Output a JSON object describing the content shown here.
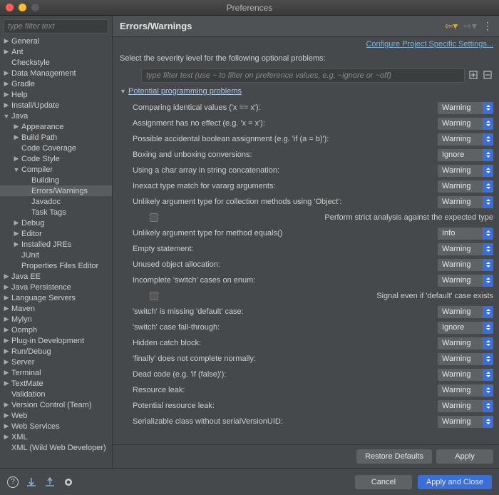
{
  "window": {
    "title": "Preferences"
  },
  "sidebar": {
    "filter_placeholder": "type filter text",
    "items": [
      {
        "l": "General",
        "d": 0,
        "t": "▶"
      },
      {
        "l": "Ant",
        "d": 0,
        "t": "▶"
      },
      {
        "l": "Checkstyle",
        "d": 0,
        "t": ""
      },
      {
        "l": "Data Management",
        "d": 0,
        "t": "▶"
      },
      {
        "l": "Gradle",
        "d": 0,
        "t": "▶"
      },
      {
        "l": "Help",
        "d": 0,
        "t": "▶"
      },
      {
        "l": "Install/Update",
        "d": 0,
        "t": "▶"
      },
      {
        "l": "Java",
        "d": 0,
        "t": "▼"
      },
      {
        "l": "Appearance",
        "d": 1,
        "t": "▶"
      },
      {
        "l": "Build Path",
        "d": 1,
        "t": "▶"
      },
      {
        "l": "Code Coverage",
        "d": 1,
        "t": ""
      },
      {
        "l": "Code Style",
        "d": 1,
        "t": "▶"
      },
      {
        "l": "Compiler",
        "d": 1,
        "t": "▼"
      },
      {
        "l": "Building",
        "d": 2,
        "t": ""
      },
      {
        "l": "Errors/Warnings",
        "d": 2,
        "t": "",
        "sel": true
      },
      {
        "l": "Javadoc",
        "d": 2,
        "t": ""
      },
      {
        "l": "Task Tags",
        "d": 2,
        "t": ""
      },
      {
        "l": "Debug",
        "d": 1,
        "t": "▶"
      },
      {
        "l": "Editor",
        "d": 1,
        "t": "▶"
      },
      {
        "l": "Installed JREs",
        "d": 1,
        "t": "▶"
      },
      {
        "l": "JUnit",
        "d": 1,
        "t": ""
      },
      {
        "l": "Properties Files Editor",
        "d": 1,
        "t": ""
      },
      {
        "l": "Java EE",
        "d": 0,
        "t": "▶"
      },
      {
        "l": "Java Persistence",
        "d": 0,
        "t": "▶"
      },
      {
        "l": "Language Servers",
        "d": 0,
        "t": "▶"
      },
      {
        "l": "Maven",
        "d": 0,
        "t": "▶"
      },
      {
        "l": "Mylyn",
        "d": 0,
        "t": "▶"
      },
      {
        "l": "Oomph",
        "d": 0,
        "t": "▶"
      },
      {
        "l": "Plug-in Development",
        "d": 0,
        "t": "▶"
      },
      {
        "l": "Run/Debug",
        "d": 0,
        "t": "▶"
      },
      {
        "l": "Server",
        "d": 0,
        "t": "▶"
      },
      {
        "l": "Terminal",
        "d": 0,
        "t": "▶"
      },
      {
        "l": "TextMate",
        "d": 0,
        "t": "▶"
      },
      {
        "l": "Validation",
        "d": 0,
        "t": ""
      },
      {
        "l": "Version Control (Team)",
        "d": 0,
        "t": "▶"
      },
      {
        "l": "Web",
        "d": 0,
        "t": "▶"
      },
      {
        "l": "Web Services",
        "d": 0,
        "t": "▶"
      },
      {
        "l": "XML",
        "d": 0,
        "t": "▶"
      },
      {
        "l": "XML (Wild Web Developer)",
        "d": 0,
        "t": ""
      }
    ]
  },
  "page": {
    "title": "Errors/Warnings",
    "config_link": "Configure Project Specific Settings...",
    "instruction": "Select the severity level for the following optional problems:",
    "filter_placeholder": "type filter text (use ~ to filter on preference values, e.g. ~ignore or ~off)",
    "category": "Potential programming problems",
    "settings": [
      {
        "label": "Comparing identical values ('x == x'):",
        "value": "Warning"
      },
      {
        "label": "Assignment has no effect (e.g. 'x = x'):",
        "value": "Warning"
      },
      {
        "label": "Possible accidental boolean assignment (e.g. 'if (a = b)'):",
        "value": "Warning"
      },
      {
        "label": "Boxing and unboxing conversions:",
        "value": "Ignore"
      },
      {
        "label": "Using a char array in string concatenation:",
        "value": "Warning"
      },
      {
        "label": "Inexact type match for vararg arguments:",
        "value": "Warning"
      },
      {
        "label": "Unlikely argument type for collection methods using 'Object':",
        "value": "Warning"
      },
      {
        "sub": true,
        "label": "Perform strict analysis against the expected type"
      },
      {
        "label": "Unlikely argument type for method equals()",
        "value": "Info"
      },
      {
        "label": "Empty statement:",
        "value": "Warning"
      },
      {
        "label": "Unused object allocation:",
        "value": "Warning"
      },
      {
        "label": "Incomplete 'switch' cases on enum:",
        "value": "Warning"
      },
      {
        "sub": true,
        "label": "Signal even if 'default' case exists"
      },
      {
        "label": "'switch' is missing 'default' case:",
        "value": "Warning"
      },
      {
        "label": "'switch' case fall-through:",
        "value": "Ignore"
      },
      {
        "label": "Hidden catch block:",
        "value": "Warning"
      },
      {
        "label": "'finally' does not complete normally:",
        "value": "Warning"
      },
      {
        "label": "Dead code (e.g. 'if (false)'):",
        "value": "Warning"
      },
      {
        "label": "Resource leak:",
        "value": "Warning"
      },
      {
        "label": "Potential resource leak:",
        "value": "Warning"
      },
      {
        "label": "Serializable class without serialVersionUID:",
        "value": "Warning"
      }
    ],
    "restore": "Restore Defaults",
    "apply": "Apply"
  },
  "footer": {
    "cancel": "Cancel",
    "apply_close": "Apply and Close"
  }
}
